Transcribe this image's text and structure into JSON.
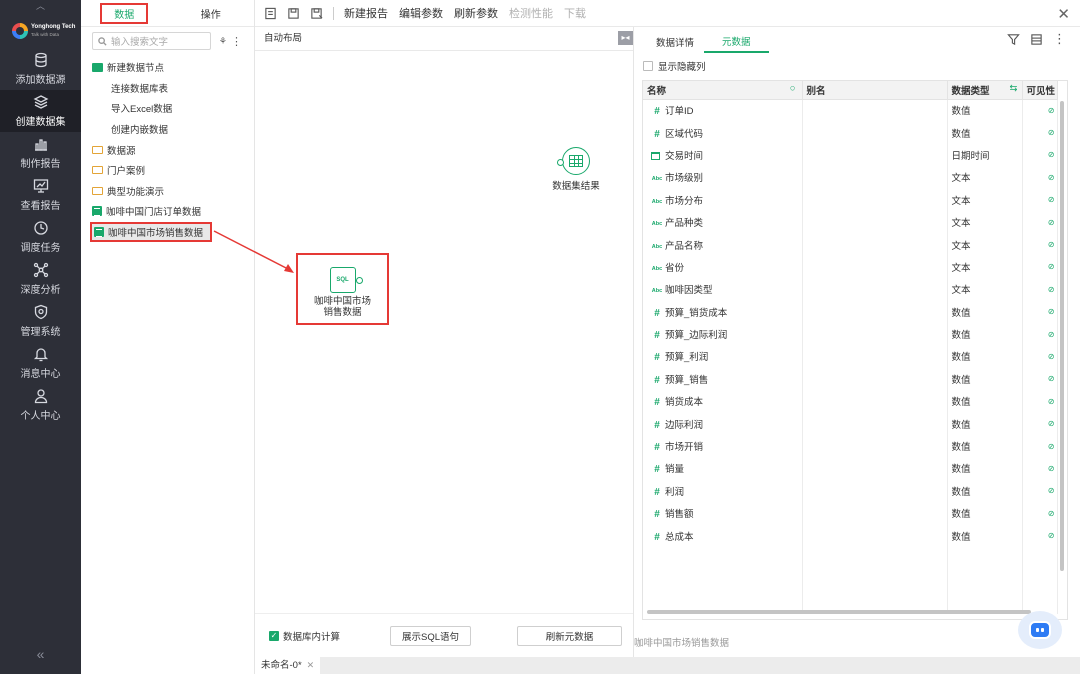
{
  "app": {
    "logo_line1": "Yonghong Tech",
    "logo_line2": "Talk with Data"
  },
  "nav": {
    "items": [
      {
        "label": "添加数据源",
        "icon": "database-icon"
      },
      {
        "label": "创建数据集",
        "icon": "layers-icon",
        "active": true
      },
      {
        "label": "制作报告",
        "icon": "bar-chart-icon"
      },
      {
        "label": "查看报告",
        "icon": "monitor-chart-icon"
      },
      {
        "label": "调度任务",
        "icon": "clock-icon"
      },
      {
        "label": "深度分析",
        "icon": "network-icon"
      },
      {
        "label": "管理系统",
        "icon": "shield-icon"
      },
      {
        "label": "消息中心",
        "icon": "bell-icon"
      },
      {
        "label": "个人中心",
        "icon": "user-icon"
      }
    ],
    "collapse_glyph": "«"
  },
  "data_panel": {
    "tab_data": "数据",
    "tab_ops": "操作",
    "search_placeholder": "输入搜索文字",
    "tree": [
      {
        "label": "新建数据节点",
        "type": "new"
      },
      {
        "label": "连接数据库表",
        "type": "child"
      },
      {
        "label": "导入Excel数据",
        "type": "child"
      },
      {
        "label": "创建内嵌数据",
        "type": "child"
      },
      {
        "label": "数据源",
        "type": "folder"
      },
      {
        "label": "门户案例",
        "type": "folder"
      },
      {
        "label": "典型功能演示",
        "type": "folder"
      },
      {
        "label": "咖啡中国门店订单数据",
        "type": "dataset"
      },
      {
        "label": "咖啡中国市场销售数据",
        "type": "dataset",
        "selected": true
      }
    ]
  },
  "toolbar": {
    "new_report": "新建报告",
    "edit_params": "编辑参数",
    "refresh_params": "刷新参数",
    "check_perf": "检测性能",
    "download": "下载"
  },
  "canvas": {
    "layout_label": "自动布局",
    "result_node_label": "数据集结果",
    "sql_icon_text": "SQL",
    "sql_node_label_line1": "咖啡中国市场",
    "sql_node_label_line2": "销售数据",
    "db_compute_label": "数据库内计算",
    "show_sql_button": "展示SQL语句",
    "refresh_meta_button": "刷新元数据"
  },
  "meta": {
    "tab_detail": "数据详情",
    "tab_meta": "元数据",
    "show_hidden": "显示隐藏列",
    "columns": {
      "name": "名称",
      "alias": "别名",
      "type": "数据类型",
      "visible": "可见性"
    },
    "rows": [
      {
        "icon": "#",
        "name": "订单ID",
        "type": "数值"
      },
      {
        "icon": "#",
        "name": "区域代码",
        "type": "数值"
      },
      {
        "icon": "cal",
        "name": "交易时间",
        "type": "日期时间"
      },
      {
        "icon": "Abc",
        "name": "市场级别",
        "type": "文本"
      },
      {
        "icon": "Abc",
        "name": "市场分布",
        "type": "文本"
      },
      {
        "icon": "Abc",
        "name": "产品种类",
        "type": "文本"
      },
      {
        "icon": "Abc",
        "name": "产品名称",
        "type": "文本"
      },
      {
        "icon": "Abc",
        "name": "省份",
        "type": "文本"
      },
      {
        "icon": "Abc",
        "name": "咖啡因类型",
        "type": "文本"
      },
      {
        "icon": "#",
        "name": "预算_销货成本",
        "type": "数值"
      },
      {
        "icon": "#",
        "name": "预算_边际利润",
        "type": "数值"
      },
      {
        "icon": "#",
        "name": "预算_利润",
        "type": "数值"
      },
      {
        "icon": "#",
        "name": "预算_销售",
        "type": "数值"
      },
      {
        "icon": "#",
        "name": "销货成本",
        "type": "数值"
      },
      {
        "icon": "#",
        "name": "边际利润",
        "type": "数值"
      },
      {
        "icon": "#",
        "name": "市场开销",
        "type": "数值"
      },
      {
        "icon": "#",
        "name": "销量",
        "type": "数值"
      },
      {
        "icon": "#",
        "name": "利润",
        "type": "数值"
      },
      {
        "icon": "#",
        "name": "销售额",
        "type": "数值"
      },
      {
        "icon": "#",
        "name": "总成本",
        "type": "数值"
      }
    ],
    "status": "咖啡中国市场销售数据"
  },
  "bottom_tabs": [
    {
      "label": "未命名-0*"
    }
  ],
  "colors": {
    "accent": "#19a86b",
    "nav_bg": "#2d2f38",
    "highlight": "#e53935"
  }
}
